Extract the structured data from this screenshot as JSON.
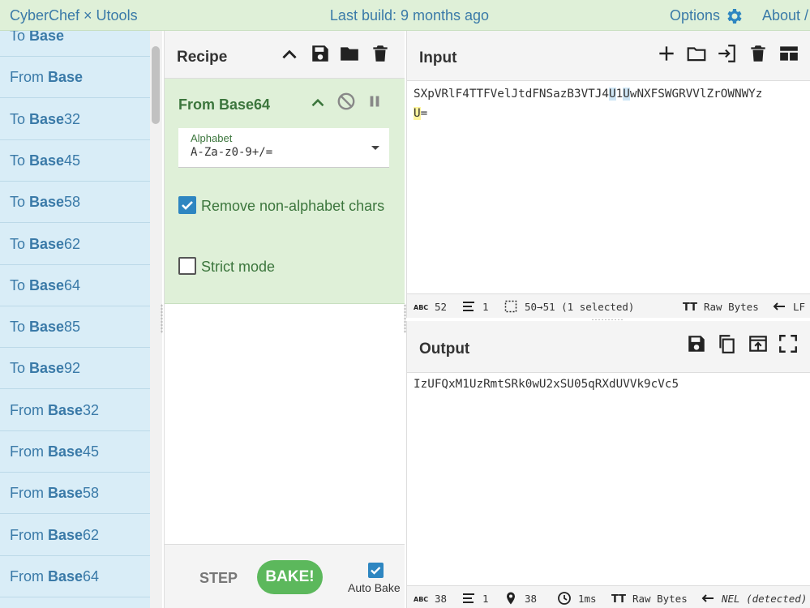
{
  "banner": {
    "title": "CyberChef × Utools",
    "last_build": "Last build: 9 months ago",
    "options": "Options",
    "about": "About /"
  },
  "operations": [
    {
      "prefix": "To ",
      "bold": "Base",
      "suffix": ""
    },
    {
      "prefix": "From ",
      "bold": "Base",
      "suffix": ""
    },
    {
      "prefix": "To ",
      "bold": "Base",
      "suffix": "32"
    },
    {
      "prefix": "To ",
      "bold": "Base",
      "suffix": "45"
    },
    {
      "prefix": "To ",
      "bold": "Base",
      "suffix": "58"
    },
    {
      "prefix": "To ",
      "bold": "Base",
      "suffix": "62"
    },
    {
      "prefix": "To ",
      "bold": "Base",
      "suffix": "64"
    },
    {
      "prefix": "To ",
      "bold": "Base",
      "suffix": "85"
    },
    {
      "prefix": "To ",
      "bold": "Base",
      "suffix": "92"
    },
    {
      "prefix": "From ",
      "bold": "Base",
      "suffix": "32"
    },
    {
      "prefix": "From ",
      "bold": "Base",
      "suffix": "45"
    },
    {
      "prefix": "From ",
      "bold": "Base",
      "suffix": "58"
    },
    {
      "prefix": "From ",
      "bold": "Base",
      "suffix": "62"
    },
    {
      "prefix": "From ",
      "bold": "Base",
      "suffix": "64"
    }
  ],
  "recipe": {
    "title": "Recipe",
    "operation": {
      "name": "From Base64",
      "alphabet_label": "Alphabet",
      "alphabet_value": "A-Za-z0-9+/=",
      "remove_non_alphabet": {
        "label": "Remove non-alphabet chars",
        "checked": true
      },
      "strict_mode": {
        "label": "Strict mode",
        "checked": false
      }
    },
    "step_label": "STEP",
    "bake_label": "BAKE!",
    "auto_bake": {
      "label": "Auto Bake",
      "checked": true
    }
  },
  "input": {
    "title": "Input",
    "line1_a": "SXpVRlF4TTFVelJtdFNSazB3VTJ4",
    "line1_b": "U",
    "line1_c": "1",
    "line1_d": "U",
    "line1_e": "wNXFSWGRVVlZrOWNWYz",
    "line2_a": "U",
    "line2_b": "=",
    "status": {
      "length": "52",
      "lines": "1",
      "selection": "50→51 (1 selected)",
      "encoding": "Raw Bytes",
      "eol": "LF"
    }
  },
  "output": {
    "title": "Output",
    "text": "IzUFQxM1UzRmtSRk0wU2xSU05qRXdUVVk9cVc5",
    "status": {
      "length": "38",
      "lines": "1",
      "position": "38",
      "time": "1ms",
      "encoding": "Raw Bytes",
      "eol": "NEL (detected)"
    }
  },
  "icons": [
    "gear-icon",
    "chevron-up-icon",
    "save-icon",
    "folder-icon",
    "trash-icon",
    "disable-icon",
    "pause-icon",
    "plus-icon",
    "import-icon",
    "layout-icon",
    "copy-icon",
    "upload-icon",
    "fullscreen-icon",
    "dropdown-caret-icon",
    "checkmark-icon"
  ],
  "colors": {
    "banner_bg": "#dff0d8",
    "ops_bg": "#d9edf7",
    "link": "#3a7aa8",
    "op_green": "#3c763d",
    "bake_green": "#5cb85c",
    "check_blue": "#2e86c1"
  }
}
